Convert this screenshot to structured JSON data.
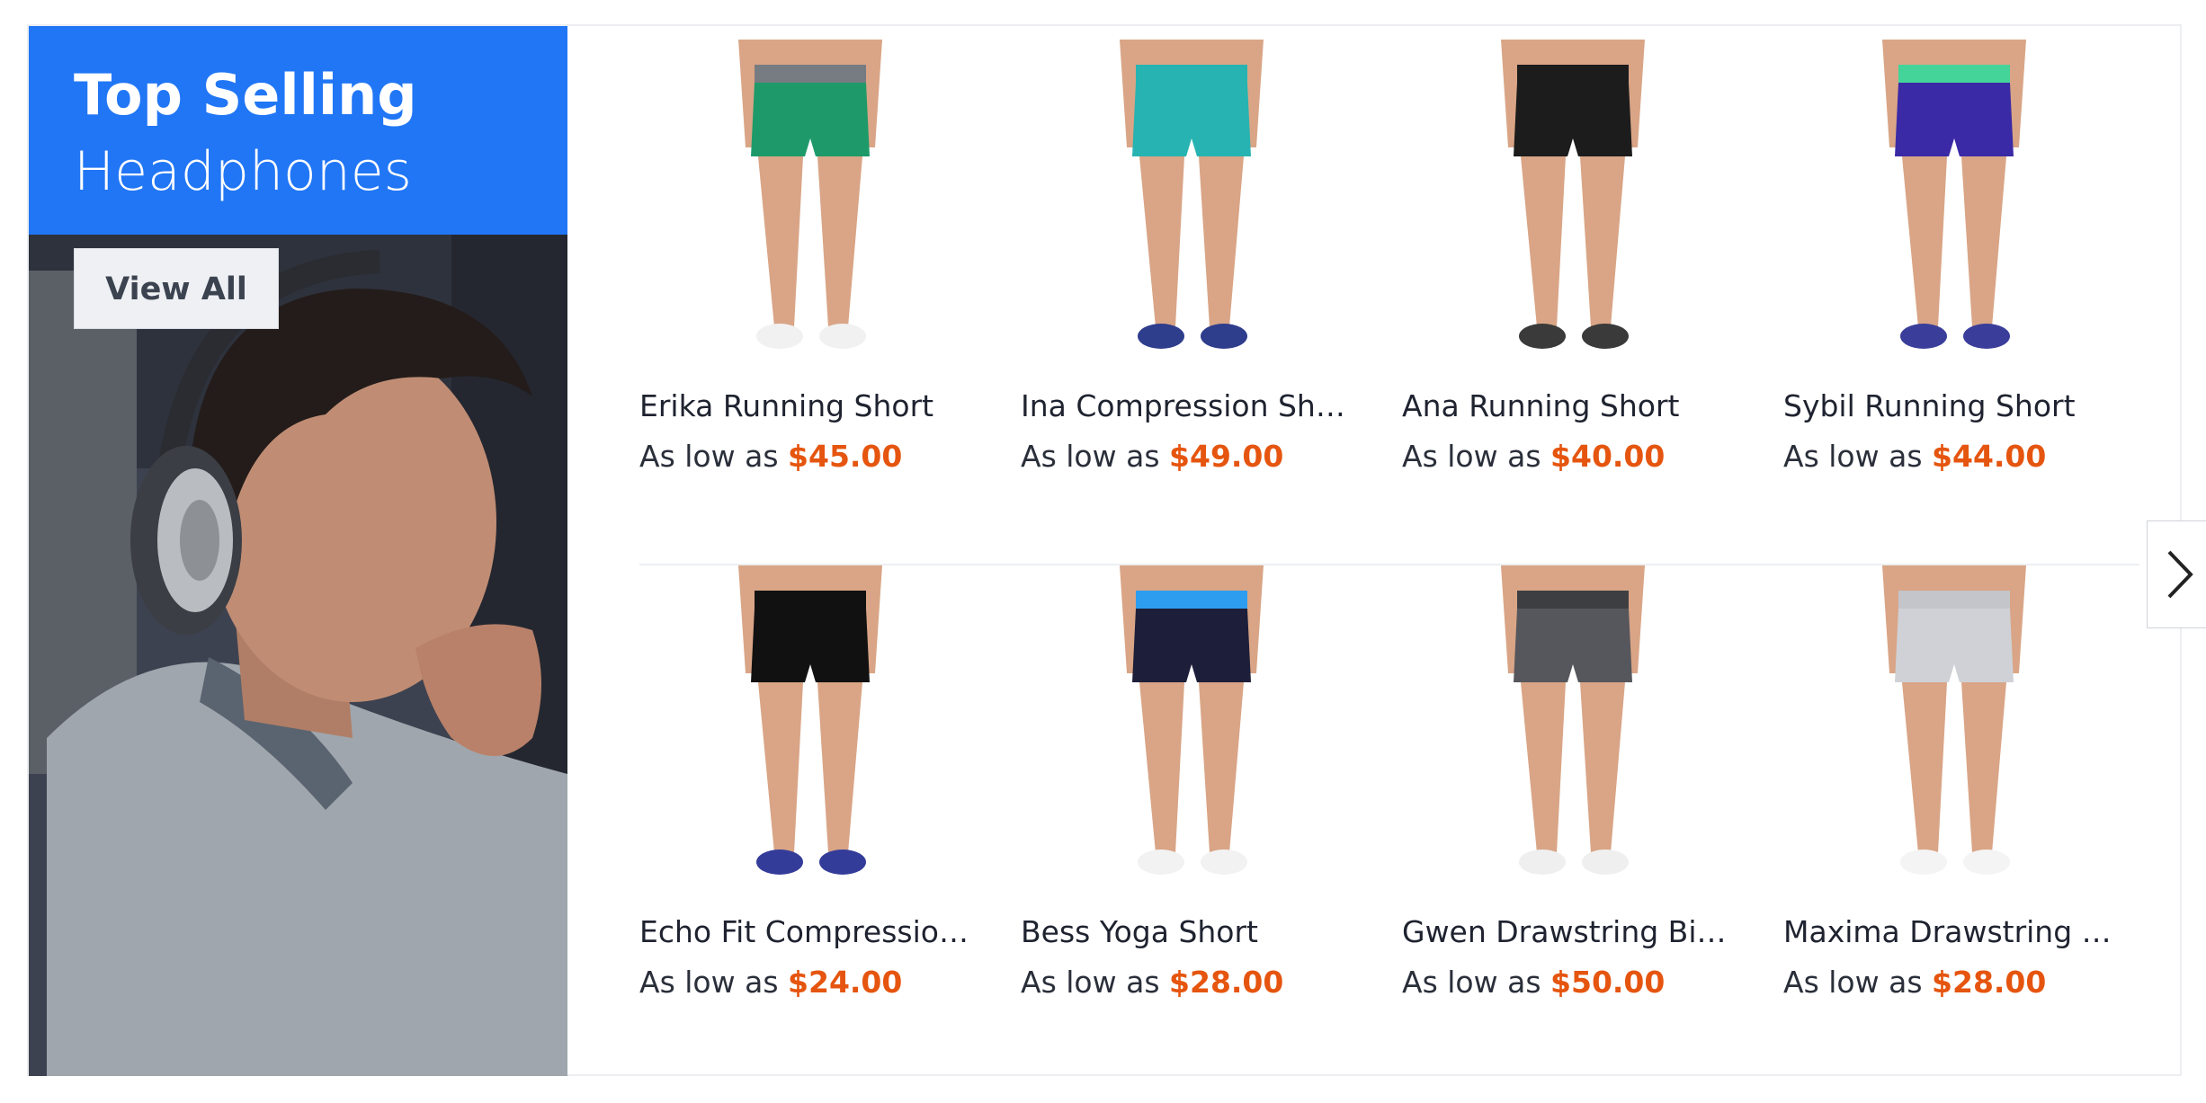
{
  "banner": {
    "title": "Top Selling",
    "subtitle": "Headphones",
    "view_all_label": "View All",
    "accent": "#2176f5"
  },
  "products": [
    {
      "name": "Erika Running Short",
      "prefix": "As low as",
      "price": "$45.00",
      "shorts_color": "#1e9a6a",
      "band_color": "#777b82",
      "shoe_color": "#f1f1f1"
    },
    {
      "name": "Ina Compression Short",
      "prefix": "As low as",
      "price": "$49.00",
      "shorts_color": "#26b3b1",
      "band_color": "#26b3b1",
      "shoe_color": "#2e3d8c"
    },
    {
      "name": "Ana Running Short",
      "prefix": "As low as",
      "price": "$40.00",
      "shorts_color": "#1c1c1c",
      "band_color": "#1c1c1c",
      "shoe_color": "#3a3a3a"
    },
    {
      "name": "Sybil Running Short",
      "prefix": "As low as",
      "price": "$44.00",
      "shorts_color": "#3b2aa6",
      "band_color": "#44d49a",
      "shoe_color": "#3a3e9a"
    },
    {
      "name": "Echo Fit Compression Short",
      "prefix": "As low as",
      "price": "$24.00",
      "shorts_color": "#111111",
      "band_color": "#111111",
      "shoe_color": "#343c9a"
    },
    {
      "name": "Bess Yoga Short",
      "prefix": "As low as",
      "price": "$28.00",
      "shorts_color": "#1d1f3a",
      "band_color": "#2d9df0",
      "shoe_color": "#f2f2f2"
    },
    {
      "name": "Gwen Drawstring Bike Short",
      "prefix": "As low as",
      "price": "$50.00",
      "shorts_color": "#56575c",
      "band_color": "#3d3e42",
      "shoe_color": "#efefef"
    },
    {
      "name": "Maxima Drawstring Short",
      "prefix": "As low as",
      "price": "$28.00",
      "shorts_color": "#cfd1d6",
      "band_color": "#c3c5ca",
      "shoe_color": "#f4f4f4"
    }
  ],
  "carousel": {
    "next_icon": "chevron-right-icon"
  },
  "colors": {
    "price": "#e5550f",
    "divider": "#eceef2"
  }
}
